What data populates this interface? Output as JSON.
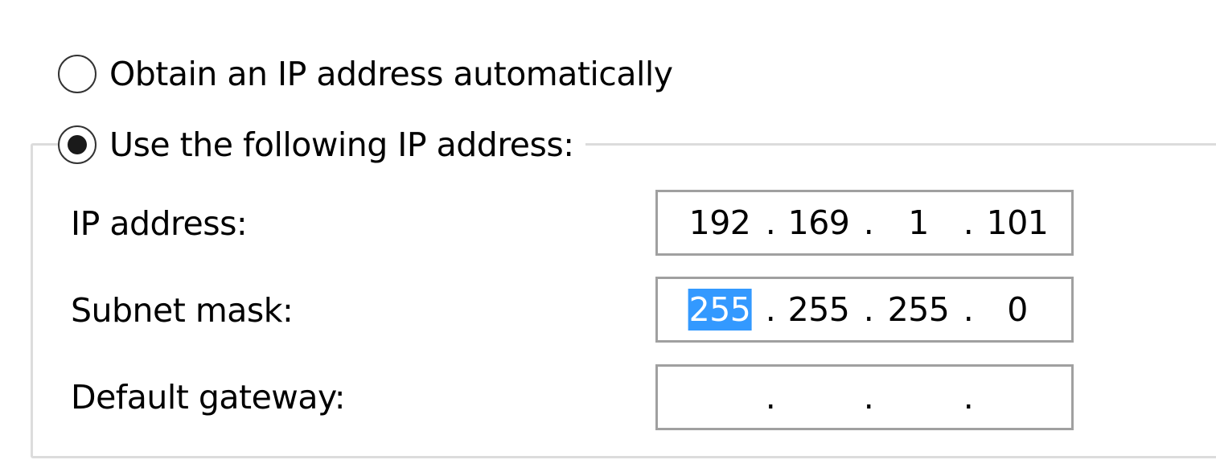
{
  "radio_options": {
    "auto": {
      "label": "Obtain an IP address automatically",
      "checked": false
    },
    "manual": {
      "label": "Use the following IP address:",
      "checked": true
    }
  },
  "fields": {
    "ip_address": {
      "label": "IP address:",
      "octets": [
        "192",
        "169",
        "1",
        "101"
      ]
    },
    "subnet_mask": {
      "label": "Subnet mask:",
      "octets": [
        "255",
        "255",
        "255",
        "0"
      ],
      "selected_octet_index": 0
    },
    "default_gateway": {
      "label": "Default gateway:",
      "octets": [
        "",
        "",
        "",
        ""
      ]
    }
  },
  "separator": ".",
  "colors": {
    "selection": "#3399ff",
    "field_border": "#a0a0a0",
    "group_border": "#dcdcdc"
  }
}
